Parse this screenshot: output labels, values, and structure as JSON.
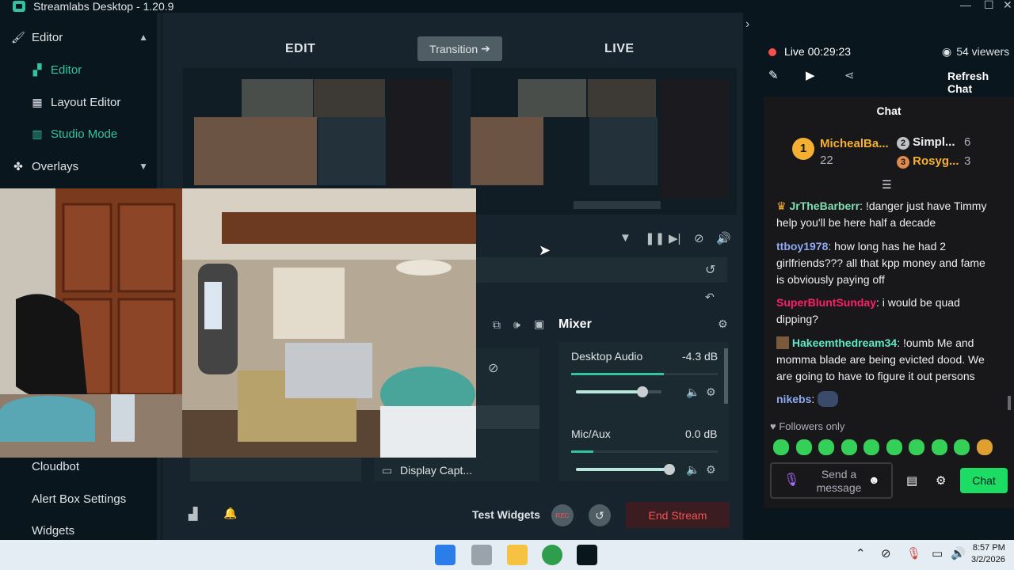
{
  "window": {
    "title": "Streamlabs Desktop - 1.20.9",
    "minimize": "—",
    "maximize": "☐",
    "close": "✕"
  },
  "sidebar": {
    "editor_section": "Editor",
    "items": [
      {
        "label": "Editor"
      },
      {
        "label": "Layout Editor"
      },
      {
        "label": "Studio Mode"
      }
    ],
    "overlays_section": "Overlays",
    "bottom_items": [
      {
        "label": "Cloudbot"
      },
      {
        "label": "Alert Box Settings"
      },
      {
        "label": "Widgets"
      }
    ]
  },
  "studio": {
    "edit_label": "EDIT",
    "live_label": "LIVE",
    "transition_label": "Transition",
    "source_name": "Display Capt..."
  },
  "mixer": {
    "title": "Mixer",
    "channels": [
      {
        "name": "Desktop Audio",
        "db": "-4.3 dB",
        "level": 0.63,
        "volume": 0.78
      },
      {
        "name": "Mic/Aux",
        "db": "0.0 dB",
        "level": 0.15,
        "volume": 1.0
      }
    ]
  },
  "footer": {
    "test_widgets": "Test Widgets",
    "rec": "REC",
    "end_stream": "End Stream"
  },
  "stream": {
    "live_label": "Live",
    "uptime": "00:29:23",
    "viewers": "54 viewers",
    "refresh_chat": "Refresh Chat"
  },
  "chat": {
    "title": "Chat",
    "leaderboard": [
      {
        "rank": "1",
        "name": "MichealBa...",
        "count": "22"
      },
      {
        "rank": "2",
        "name": "Simpl...",
        "count": "6"
      },
      {
        "rank": "3",
        "name": "Rosyg...",
        "count": "3"
      }
    ],
    "messages": [
      {
        "user": "JrTheBarberr",
        "text": "!danger just have Timmy help you'll be here half a decade",
        "color": "#7ee0b4"
      },
      {
        "user": "ttboy1978",
        "text": "how long has he had 2 girlfriends??? all that kpp money and fame is obviously paying off",
        "color": "#8fa8f2"
      },
      {
        "user": "SuperBluntSunday",
        "text": "i would be quad dipping?",
        "color": "#ff1f66"
      },
      {
        "user": "Hakeemthedream34",
        "text": "!oumb Me and momma blade are being evicted dood. We are going to have to figure it out persons",
        "color": "#5ee8c5"
      },
      {
        "user": "nikebs",
        "text": "",
        "color": "#8fa8f2"
      }
    ],
    "followers_only": "Followers only",
    "input_placeholder": "Send a message",
    "send_label": "Chat"
  },
  "taskbar": {
    "time": "8:57 PM",
    "date": "3/2/2026"
  }
}
